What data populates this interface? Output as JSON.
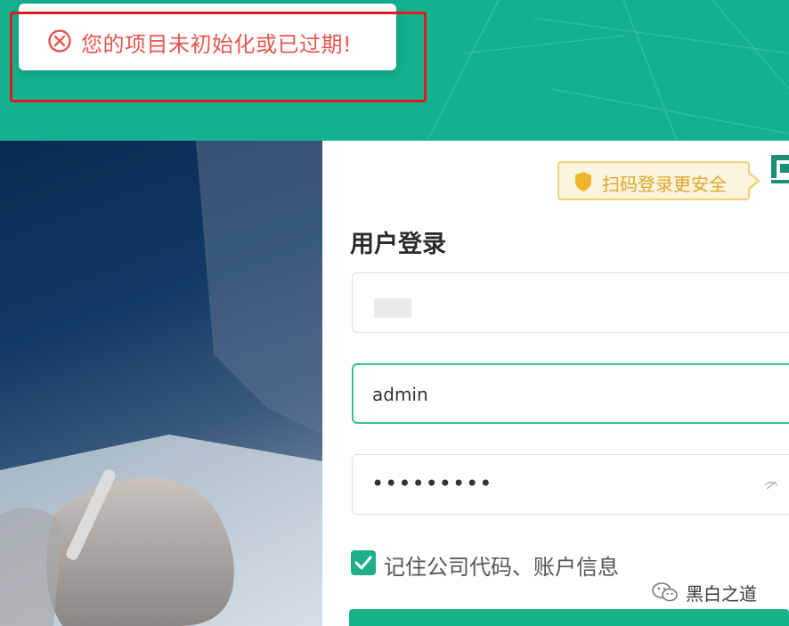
{
  "toast": {
    "icon": "error-circle-icon",
    "message": "您的项目未初始化或已过期!",
    "color": "#e8574f"
  },
  "qr_tip": {
    "icon": "shield-icon",
    "text": "扫码登录更安全"
  },
  "login": {
    "title": "用户登录",
    "company_field": {
      "value": ""
    },
    "username_field": {
      "value": "admin"
    },
    "password_field": {
      "value": "•••••••••"
    },
    "remember": {
      "checked": true,
      "label": "记住公司代码、账户信息"
    }
  },
  "watermark": {
    "icon": "wechat-icon",
    "text": "黑白之道"
  },
  "colors": {
    "brand": "#14b08f",
    "error": "#e8574f",
    "highlight": "#e01b1b",
    "tip_bg": "#fdf4dd",
    "tip_text": "#e0a52a"
  }
}
